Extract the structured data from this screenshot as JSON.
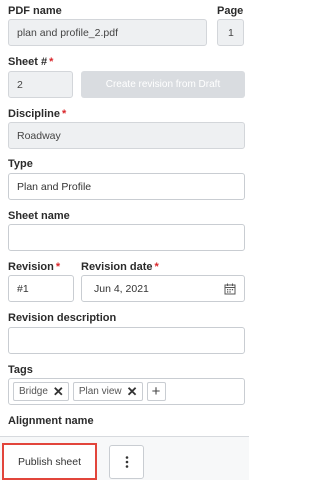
{
  "pdf_name": {
    "label": "PDF name",
    "value": "plan and profile_2.pdf"
  },
  "page": {
    "label": "Page",
    "value": "1"
  },
  "sheet_number": {
    "label": "Sheet #",
    "required": "*",
    "value": "2"
  },
  "create_revision_button": "Create revision from Draft",
  "discipline": {
    "label": "Discipline",
    "required": "*",
    "value": "Roadway"
  },
  "type": {
    "label": "Type",
    "value": "Plan and Profile"
  },
  "sheet_name": {
    "label": "Sheet name",
    "value": ""
  },
  "revision": {
    "label": "Revision",
    "required": "*",
    "value": "#1"
  },
  "revision_date": {
    "label": "Revision date",
    "required": "*",
    "value": "Jun 4, 2021",
    "icon": "calendar-icon"
  },
  "revision_description": {
    "label": "Revision description",
    "value": ""
  },
  "tags": {
    "label": "Tags",
    "items": [
      {
        "label": "Bridge",
        "remove_icon": "close-icon"
      },
      {
        "label": "Plan view",
        "remove_icon": "close-icon"
      }
    ],
    "add_icon": "plus-icon"
  },
  "alignment_name": {
    "label": "Alignment name"
  },
  "footer": {
    "publish_button": "Publish sheet",
    "more_icon": "more-vertical-icon",
    "highlight_color": "#e2453b"
  }
}
